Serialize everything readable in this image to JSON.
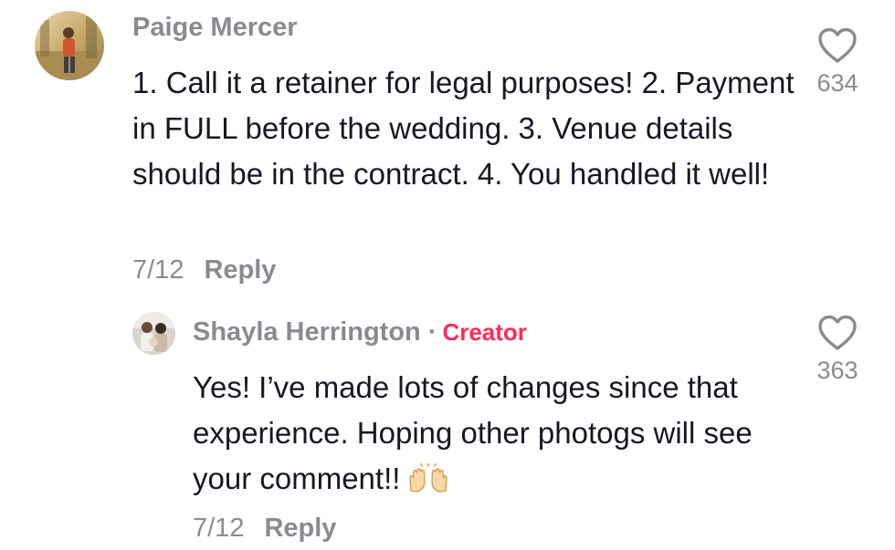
{
  "comments": [
    {
      "username": "Paige Mercer",
      "text": "1. Call it a retainer for legal purposes! 2. Payment in FULL before the wedding. 3. Venue details should be in the contract. 4. You handled it well!",
      "date": "7/12",
      "reply_label": "Reply",
      "like_count": "634",
      "like_icon": "heart-outline-icon"
    }
  ],
  "replies": [
    {
      "username": "Shayla Herrington",
      "separator": "·",
      "badge": "Creator",
      "text": "Yes! I’ve made lots of changes since that experience. Hoping other photogs will see your comment!!",
      "emoji": "raising-hands-emoji",
      "date": "7/12",
      "reply_label": "Reply",
      "like_count": "363",
      "like_icon": "heart-outline-icon"
    }
  ],
  "colors": {
    "text_primary": "#161823",
    "text_secondary": "#8a8b91",
    "creator_badge": "#fe2c55"
  }
}
